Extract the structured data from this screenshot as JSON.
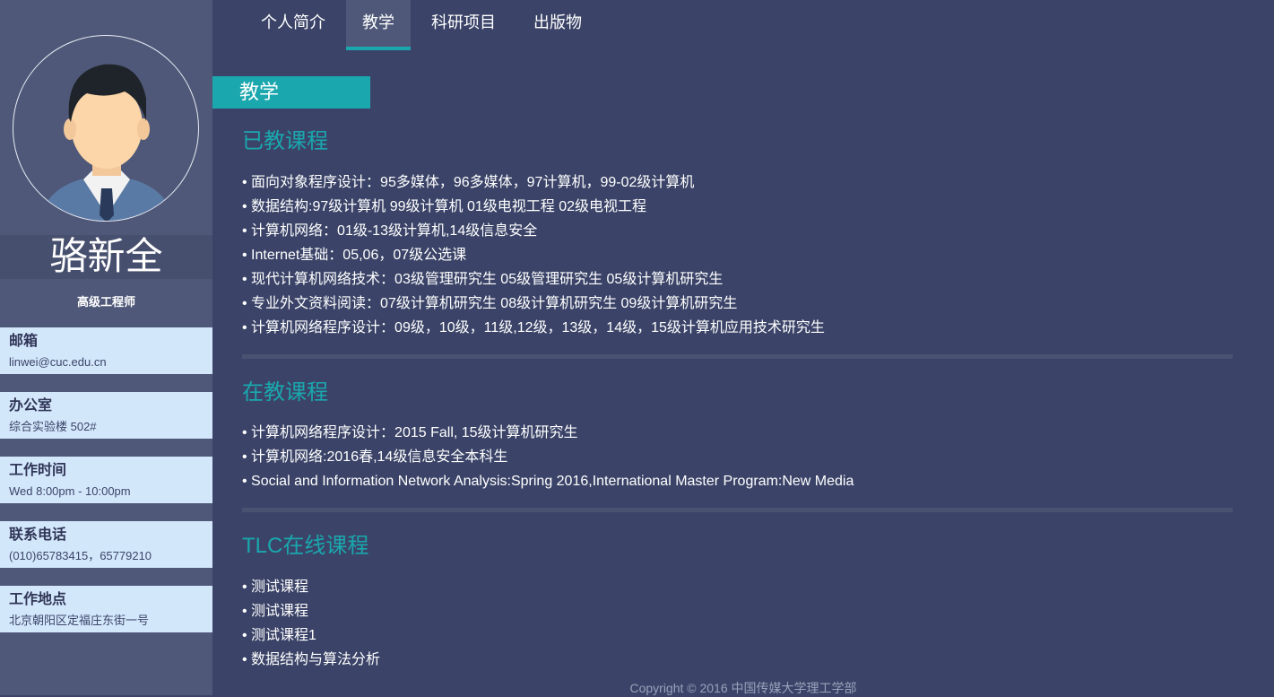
{
  "profile": {
    "name": "骆新全",
    "title": "高级工程师"
  },
  "contact": [
    {
      "label": "邮箱",
      "value": "linwei@cuc.edu.cn"
    },
    {
      "label": "办公室",
      "value": "综合实验楼 502#"
    },
    {
      "label": "工作时间",
      "value": "Wed 8:00pm - 10:00pm"
    },
    {
      "label": "联系电话",
      "value": "(010)65783415，65779210"
    },
    {
      "label": "工作地点",
      "value": "北京朝阳区定福庄东街一号"
    }
  ],
  "nav": {
    "tabs": [
      {
        "label": "个人简介",
        "active": false
      },
      {
        "label": "教学",
        "active": true
      },
      {
        "label": "科研项目",
        "active": false
      },
      {
        "label": "出版物",
        "active": false
      }
    ]
  },
  "main": {
    "section_title": "教学",
    "taught": {
      "heading": "已教课程",
      "items": [
        "面向对象程序设计：95多媒体，96多媒体，97计算机，99-02级计算机",
        "数据结构:97级计算机 99级计算机 01级电视工程 02级电视工程",
        "计算机网络：01级-13级计算机,14级信息安全",
        "Internet基础：05,06，07级公选课",
        "现代计算机网络技术：03级管理研究生 05级管理研究生 05级计算机研究生",
        "专业外文资料阅读：07级计算机研究生 08级计算机研究生 09级计算机研究生",
        "计算机网络程序设计：09级，10级，11级,12级，13级，14级，15级计算机应用技术研究生"
      ]
    },
    "current": {
      "heading": "在教课程",
      "items": [
        "计算机网络程序设计：2015 Fall, 15级计算机研究生",
        "计算机网络:2016春,14级信息安全本科生",
        "Social and Information Network Analysis:Spring 2016,International Master Program:New Media"
      ]
    },
    "online": {
      "heading": "TLC在线课程",
      "items": [
        "测试课程",
        "测试课程",
        "测试课程1",
        "数据结构与算法分析"
      ]
    }
  },
  "footer": {
    "copyright": "Copyright © 2016 中国传媒大学理工学部"
  },
  "colors": {
    "background": "#3b4468",
    "sidebar": "#4f5878",
    "accent": "#1aa7ad",
    "card": "#d3e7fb"
  }
}
